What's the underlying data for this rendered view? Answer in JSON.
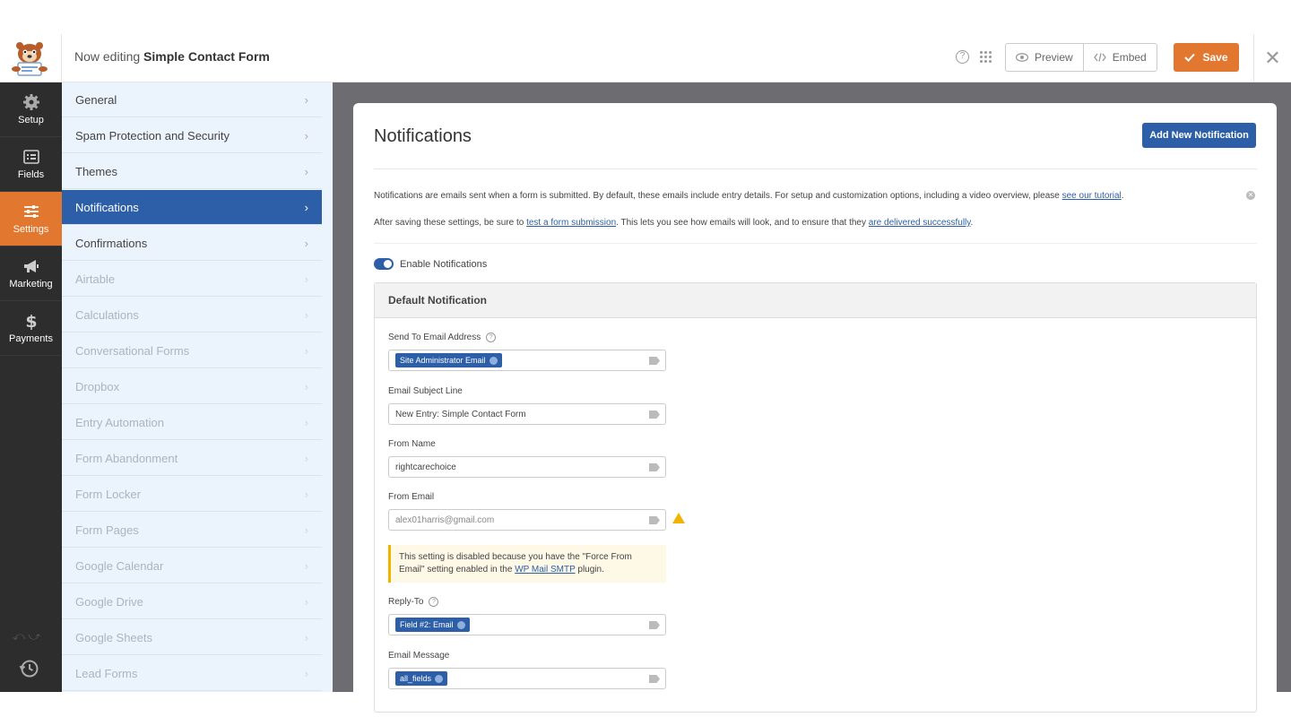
{
  "header": {
    "editing_prefix": "Now editing",
    "form_name": "Simple Contact Form",
    "preview_label": "Preview",
    "embed_label": "Embed",
    "save_label": "Save"
  },
  "leftnav": [
    {
      "label": "Setup",
      "icon": "gear-icon"
    },
    {
      "label": "Fields",
      "icon": "fields-icon"
    },
    {
      "label": "Settings",
      "icon": "sliders-icon"
    },
    {
      "label": "Marketing",
      "icon": "megaphone-icon"
    },
    {
      "label": "Payments",
      "icon": "dollar-icon"
    }
  ],
  "settings_panel": [
    {
      "label": "General",
      "state": "normal"
    },
    {
      "label": "Spam Protection and Security",
      "state": "normal"
    },
    {
      "label": "Themes",
      "state": "normal"
    },
    {
      "label": "Notifications",
      "state": "active"
    },
    {
      "label": "Confirmations",
      "state": "normal"
    },
    {
      "label": "Airtable",
      "state": "disabled"
    },
    {
      "label": "Calculations",
      "state": "disabled"
    },
    {
      "label": "Conversational Forms",
      "state": "disabled"
    },
    {
      "label": "Dropbox",
      "state": "disabled"
    },
    {
      "label": "Entry Automation",
      "state": "disabled"
    },
    {
      "label": "Form Abandonment",
      "state": "disabled"
    },
    {
      "label": "Form Locker",
      "state": "disabled"
    },
    {
      "label": "Form Pages",
      "state": "disabled"
    },
    {
      "label": "Google Calendar",
      "state": "disabled"
    },
    {
      "label": "Google Drive",
      "state": "disabled"
    },
    {
      "label": "Google Sheets",
      "state": "disabled"
    },
    {
      "label": "Lead Forms",
      "state": "disabled"
    }
  ],
  "main": {
    "title": "Notifications",
    "add_button": "Add New Notification",
    "info1_text": "Notifications are emails sent when a form is submitted. By default, these emails include entry details. For setup and customization options, including a video overview, please ",
    "info1_link": "see our tutorial",
    "info2_text_a": "After saving these settings, be sure to ",
    "info2_link_a": "test a form submission",
    "info2_text_b": ". This lets you see how emails will look, and to ensure that they ",
    "info2_link_b": "are delivered successfully",
    "enable_label": "Enable Notifications",
    "notification_title": "Default Notification",
    "fields": {
      "send_to_label": "Send To Email Address",
      "send_to_chip": "Site Administrator Email",
      "subject_label": "Email Subject Line",
      "subject_value": "New Entry: Simple Contact Form",
      "from_name_label": "From Name",
      "from_name_value": "rightcarechoice",
      "from_email_label": "From Email",
      "from_email_value": "alex01harris@gmail.com",
      "notice_a": "This setting is disabled because you have the \"Force From Email\" setting enabled in the ",
      "notice_link": "WP Mail SMTP",
      "notice_b": " plugin.",
      "reply_to_label": "Reply-To",
      "reply_to_chip": "Field #2: Email",
      "message_label": "Email Message",
      "message_chip": "all_fields"
    }
  }
}
